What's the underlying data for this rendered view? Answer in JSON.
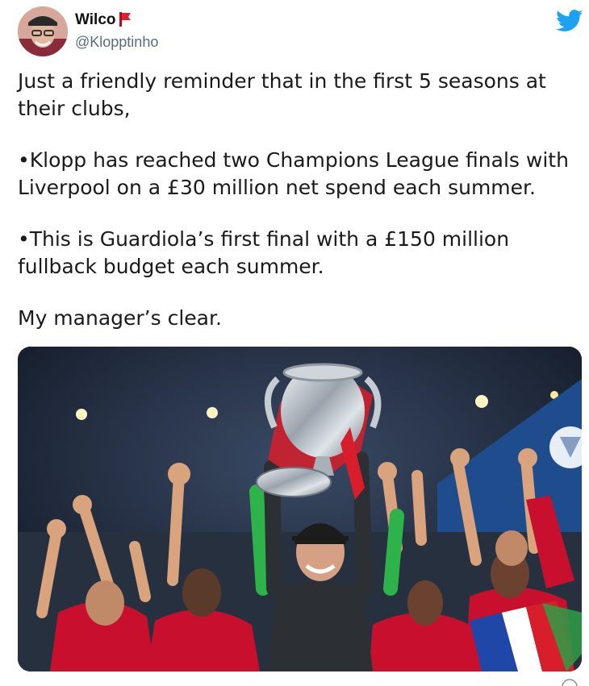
{
  "user": {
    "display_name": "Wilco",
    "handle": "@Klopptinho",
    "avatar_icon": "avatar-photo",
    "name_emoji_icon": "red-flag-emoji-icon"
  },
  "brand": {
    "icon": "twitter-bird-icon",
    "color": "#1da1f2"
  },
  "tweet": {
    "paragraphs": [
      "Just a friendly reminder that in the first 5 seasons at their clubs,",
      "•Klopp has reached two Champions League finals with Liverpool on a £30 million net spend each summer.",
      "•This is Guardiola’s first final with a £150 million fullback budget each summer.",
      "My manager’s clear."
    ]
  },
  "media": {
    "kind": "photo",
    "colors": {
      "kit_red": "#c8102e",
      "trophy_ribbon": "#d81e2a",
      "background_blue": "#1f4c8c"
    }
  }
}
